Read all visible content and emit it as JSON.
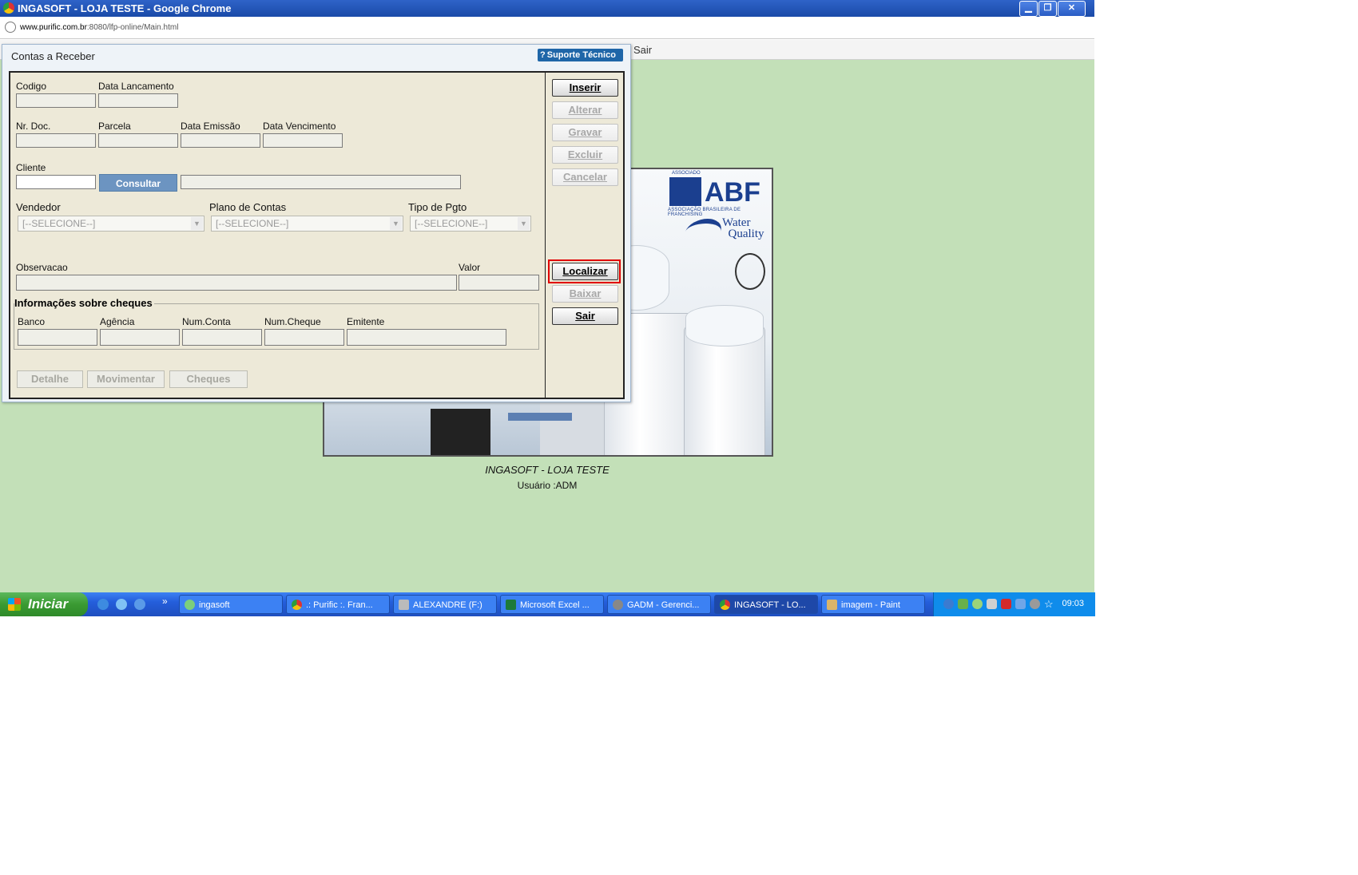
{
  "window": {
    "title": "INGASOFT - LOJA TESTE - Google Chrome"
  },
  "address": {
    "host": "www.purific.com.br",
    "path": ":8080/lfp-online/Main.html"
  },
  "menubar": {
    "sair": "Sair"
  },
  "banner": {
    "assoc": "ASSOCIADO",
    "abf": "ABF",
    "abf_sub": "ASSOCIAÇÃO BRASILEIRA DE FRANCHISING",
    "water_quality_1": "Water",
    "water_quality_2": "Quality"
  },
  "footer": {
    "brand": "INGASOFT - LOJA TESTE",
    "user": "Usuário :ADM"
  },
  "dialog": {
    "title": "Contas a Receber",
    "suporte": "Suporte Técnico",
    "labels": {
      "codigo": "Codigo",
      "data_lancamento": "Data Lancamento",
      "nr_doc": "Nr. Doc.",
      "parcela": "Parcela",
      "data_emissao": "Data Emissão",
      "data_vencimento": "Data Vencimento",
      "cliente": "Cliente",
      "vendedor": "Vendedor",
      "plano_contas": "Plano de Contas",
      "tipo_pgto": "Tipo de Pgto",
      "observacao": "Observacao",
      "valor": "Valor",
      "cheques_section": "Informações sobre cheques",
      "banco": "Banco",
      "agencia": "Agência",
      "num_conta": "Num.Conta",
      "num_cheque": "Num.Cheque",
      "emitente": "Emitente"
    },
    "consultar": "Consultar",
    "selects": {
      "vendedor": "[--SELECIONE--]",
      "plano_contas": "[--SELECIONE--]",
      "tipo_pgto": "[--SELECIONE--]"
    },
    "bottom_buttons": [
      "Detalhe",
      "Movimentar",
      "Cheques"
    ],
    "actions": [
      {
        "label": "Inserir",
        "enabled": true
      },
      {
        "label": "Alterar",
        "enabled": false
      },
      {
        "label": "Gravar",
        "enabled": false
      },
      {
        "label": "Excluir",
        "enabled": false
      },
      {
        "label": "Cancelar",
        "enabled": false
      },
      {
        "label": "Localizar",
        "enabled": true,
        "highlighted": true
      },
      {
        "label": "Baixar",
        "enabled": false
      },
      {
        "label": "Sair",
        "enabled": true
      }
    ]
  },
  "taskbar": {
    "start": "Iniciar",
    "tasks": [
      "ingasoft",
      ".: Purific :. Fran...",
      "ALEXANDRE (F:)",
      "Microsoft Excel ...",
      "GADM - Gerenci...",
      "INGASOFT - LO...",
      "imagem - Paint"
    ],
    "clock": "09:03"
  },
  "colors": {
    "app_bg": "#c3e0b8",
    "form_bg": "#ede9d8",
    "highlight": "#e00000",
    "taskbar": "#245edb"
  }
}
